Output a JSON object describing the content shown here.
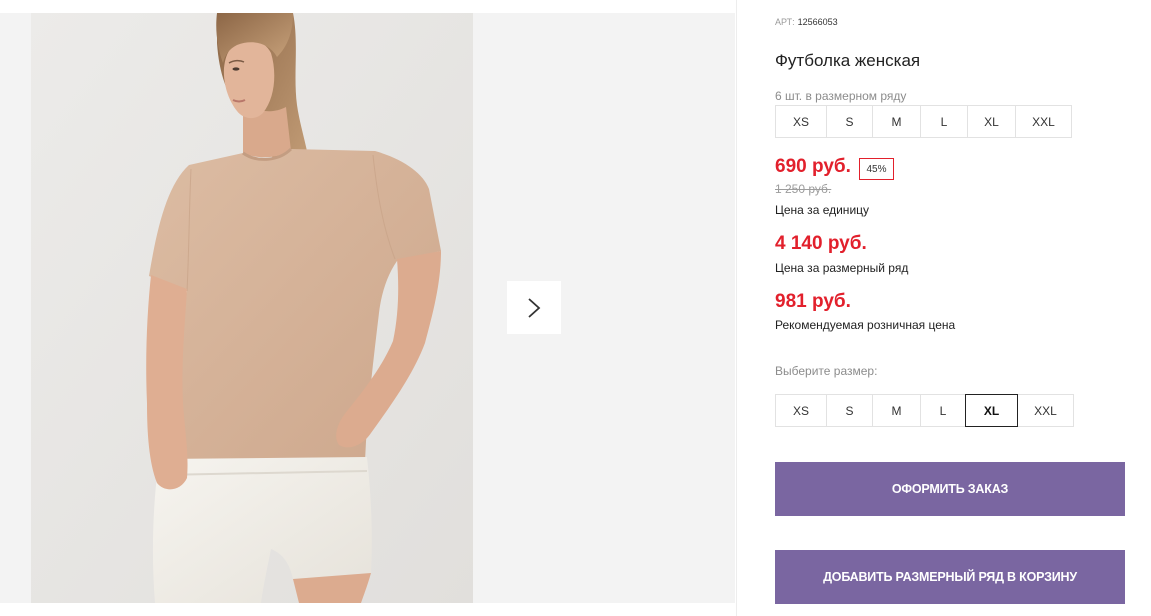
{
  "gallery": {
    "next_icon": "chevron-right-icon"
  },
  "product": {
    "article_label": "АРТ:",
    "article_number": "12566053",
    "title": "Футболка женская",
    "pack_note": "6 шт. в размерном ряду",
    "pack_sizes": [
      "XS",
      "S",
      "M",
      "L",
      "XL",
      "XXL"
    ],
    "unit_price": "690 руб.",
    "discount": "45%",
    "old_price": "1 250 руб.",
    "unit_price_caption": "Цена за единицу",
    "pack_price": "4 140 руб.",
    "pack_price_caption": "Цена за размерный ряд",
    "retail_price": "981 руб.",
    "retail_price_caption": "Рекомендуемая розничная цена"
  },
  "size_selector": {
    "label": "Выберите размер:",
    "options": [
      {
        "label": "XS",
        "selected": false
      },
      {
        "label": "S",
        "selected": false
      },
      {
        "label": "M",
        "selected": false
      },
      {
        "label": "L",
        "selected": false
      },
      {
        "label": "XL",
        "selected": true
      },
      {
        "label": "XXL",
        "selected": false
      }
    ]
  },
  "actions": {
    "checkout_label": "ОФОРМИТЬ ЗАКАЗ",
    "add_pack_label": "ДОБАВИТЬ РАЗМЕРНЫЙ РЯД В КОРЗИНУ"
  },
  "colors": {
    "accent": "#7a66a1",
    "price": "#e2202c",
    "gallery_background": "#f3f3f3"
  }
}
